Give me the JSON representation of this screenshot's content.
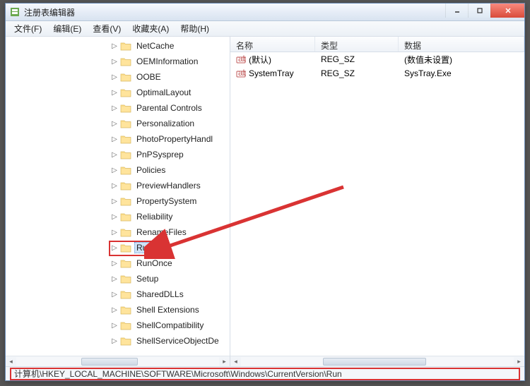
{
  "window": {
    "title": "注册表编辑器"
  },
  "menu": {
    "file": "文件(F)",
    "edit": "编辑(E)",
    "view": "查看(V)",
    "favorites": "收藏夹(A)",
    "help": "帮助(H)"
  },
  "tree": {
    "items": [
      {
        "label": "NetCache"
      },
      {
        "label": "OEMInformation"
      },
      {
        "label": "OOBE"
      },
      {
        "label": "OptimalLayout"
      },
      {
        "label": "Parental Controls"
      },
      {
        "label": "Personalization"
      },
      {
        "label": "PhotoPropertyHandl"
      },
      {
        "label": "PnPSysprep"
      },
      {
        "label": "Policies"
      },
      {
        "label": "PreviewHandlers"
      },
      {
        "label": "PropertySystem"
      },
      {
        "label": "Reliability"
      },
      {
        "label": "RenameFiles"
      },
      {
        "label": "Run",
        "selected": true
      },
      {
        "label": "RunOnce"
      },
      {
        "label": "Setup"
      },
      {
        "label": "SharedDLLs"
      },
      {
        "label": "Shell Extensions"
      },
      {
        "label": "ShellCompatibility"
      },
      {
        "label": "ShellServiceObjectDe"
      }
    ]
  },
  "list": {
    "headers": {
      "name": "名称",
      "type": "类型",
      "data": "数据"
    },
    "rows": [
      {
        "name": "(默认)",
        "type": "REG_SZ",
        "data": "(数值未设置)"
      },
      {
        "name": "SystemTray",
        "type": "REG_SZ",
        "data": "SysTray.Exe"
      }
    ]
  },
  "status": {
    "path": "计算机\\HKEY_LOCAL_MACHINE\\SOFTWARE\\Microsoft\\Windows\\CurrentVersion\\Run"
  },
  "colors": {
    "highlight": "#d93333"
  }
}
